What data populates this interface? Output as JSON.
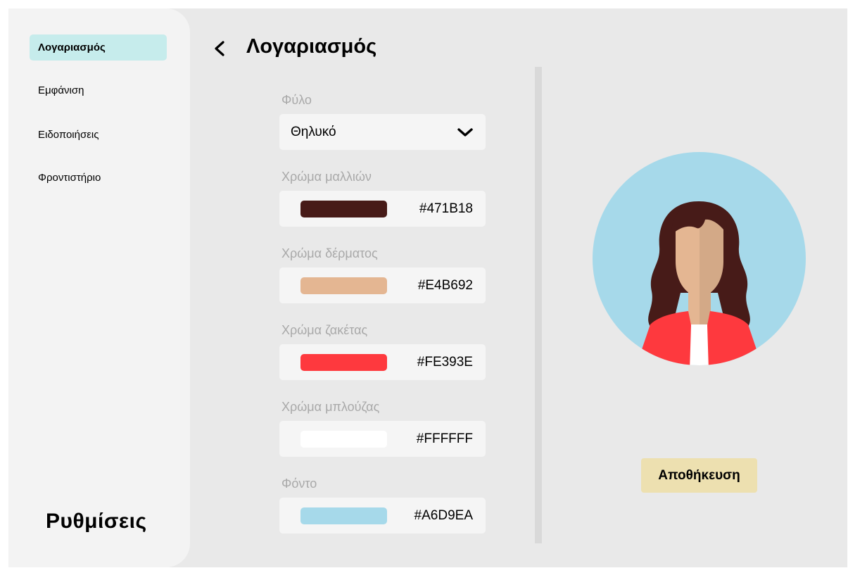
{
  "sidebar": {
    "items": [
      {
        "label": "Λογαριασμός",
        "active": true
      },
      {
        "label": "Εμφάνιση",
        "active": false
      },
      {
        "label": "Ειδοποιήσεις",
        "active": false
      },
      {
        "label": "Φροντιστήριο",
        "active": false
      }
    ],
    "title": "Ρυθμίσεις"
  },
  "header": {
    "back_icon": "chevron-left-icon",
    "title": "Λογαριασμός"
  },
  "form": {
    "gender": {
      "label": "Φύλο",
      "value": "Θηλυκό",
      "icon": "chevron-down-icon"
    },
    "colors": [
      {
        "label": "Χρώμα μαλλιών",
        "hex": "#471B18"
      },
      {
        "label": "Χρώμα δέρματος",
        "hex": "#E4B692"
      },
      {
        "label": "Χρώμα ζακέτας",
        "hex": "#FE393E"
      },
      {
        "label": "Χρώμα μπλούζας",
        "hex": "#FFFFFF"
      },
      {
        "label": "Φόντο",
        "hex": "#A6D9EA"
      }
    ]
  },
  "preview": {
    "save_label": "Αποθήκευση",
    "save_color": "#EDE0B0"
  },
  "theme": {
    "active_nav": "#C6ECEC",
    "background": "#E9E9E9"
  }
}
